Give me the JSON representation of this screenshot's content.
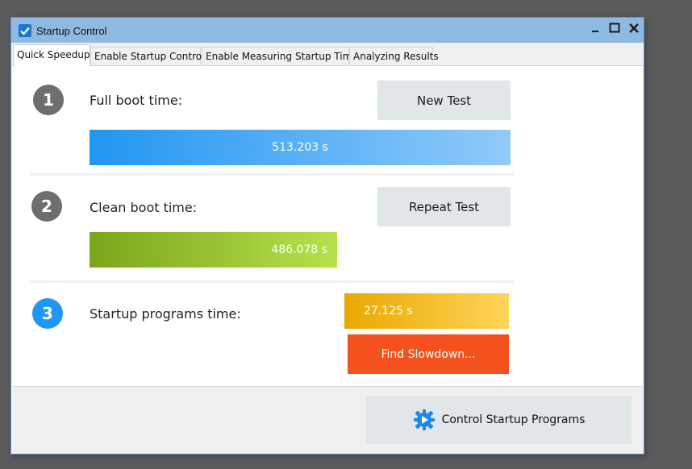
{
  "window": {
    "title": "Startup Control",
    "controls": {
      "minimize": "minimize-icon",
      "maximize": "maximize-icon",
      "close": "close-icon"
    }
  },
  "tabs": [
    {
      "label": "Quick Speedup",
      "active": true
    },
    {
      "label": "Enable Startup Control",
      "active": false
    },
    {
      "label": "Enable Measuring Startup Time",
      "active": false
    },
    {
      "label": "Analyzing Results",
      "active": false
    }
  ],
  "steps": [
    {
      "number": "1",
      "label": "Full boot time:",
      "button": "New Test",
      "value": "513.203 s",
      "circle_color": "#6e6e6e",
      "bar_gradient": [
        "#2196f3",
        "#90caf9"
      ]
    },
    {
      "number": "2",
      "label": "Clean boot time:",
      "button": "Repeat Test",
      "value": "486.078 s",
      "circle_color": "#6e6e6e",
      "bar_gradient": [
        "#7aa51c",
        "#b5e24a"
      ]
    },
    {
      "number": "3",
      "label": "Startup programs time:",
      "value": "27.125 s",
      "button": "Find Slowdown...",
      "circle_color": "#2196f3",
      "bar_gradient": [
        "#e8a800",
        "#ffd559"
      ],
      "button_color": "#f4511e"
    }
  ],
  "footer": {
    "button": "Control Startup Programs",
    "icon": "gear-play-icon"
  }
}
